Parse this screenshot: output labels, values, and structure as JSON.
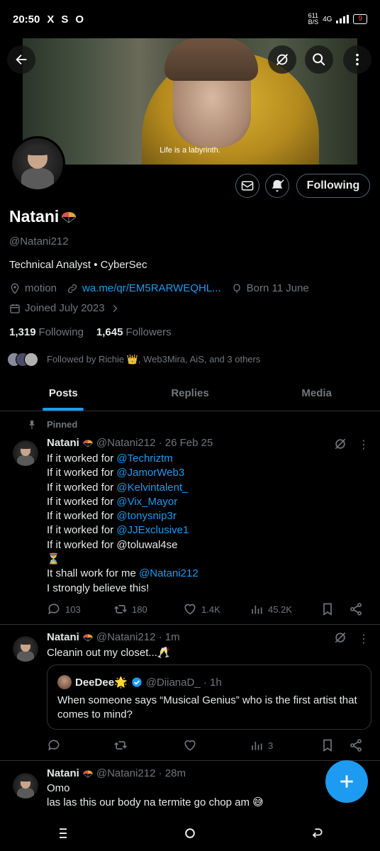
{
  "status_bar": {
    "time": "20:50",
    "left_icons": [
      "X",
      "S",
      "O"
    ],
    "net_speed": "611\nB/S",
    "network": "4G",
    "battery": "9"
  },
  "header": {
    "banner_caption": "Life is a labyrinth."
  },
  "profile": {
    "name": "Natani",
    "handle": "@Natani212",
    "bio": "Technical Analyst • CyberSec",
    "location": "motion",
    "link": "wa.me/qr/EM5RARWEQHL...",
    "birthday": "Born 11 June",
    "joined": "Joined July 2023",
    "following_count": "1,319",
    "following_label": "Following",
    "followers_count": "1,645",
    "followers_label": "Followers",
    "followed_by": "Followed by Richie 👑, Web3Mira, AiS, and 3 others",
    "following_button": "Following"
  },
  "tabs": [
    {
      "label": "Posts",
      "active": true
    },
    {
      "label": "Replies",
      "active": false
    },
    {
      "label": "Media",
      "active": false
    }
  ],
  "tweets": [
    {
      "pinned_label": "Pinned",
      "name": "Natani",
      "handle_time": "@Natani212 · 26 Feb 25",
      "lines": [
        {
          "text": "If it worked for ",
          "mention": "@Techriztm"
        },
        {
          "text": "If it worked for ",
          "mention": "@JamorWeb3"
        },
        {
          "text": "If it  worked for ",
          "mention": "@Kelvintalent_"
        },
        {
          "text": "If it  worked for ",
          "mention": "@Vix_Mayor"
        },
        {
          "text": "If it  worked for ",
          "mention": "@tonysnip3r"
        },
        {
          "text": "If it  worked for ",
          "mention": "@JJExclusive1"
        },
        {
          "text": "If it  worked for @toluwal4se",
          "mention": ""
        },
        {
          "text": "⏳",
          "mention": ""
        },
        {
          "text": "It shall work for me ",
          "mention": "@Natani212"
        },
        {
          "text": "I strongly believe this!",
          "mention": ""
        }
      ],
      "replies": "103",
      "retweets": "180",
      "likes": "1.4K",
      "views": "45.2K"
    },
    {
      "name": "Natani",
      "handle_time": "@Natani212 · 1m",
      "text": "Cleanin out my closet...🥂",
      "quote": {
        "name": "DeeDee🌟",
        "handle_time": "@DiianaD_ · 1h",
        "text": "When someone says “Musical Genius” who is the first artist that comes to mind?"
      },
      "views": "3"
    },
    {
      "name": "Natani",
      "handle_time": "@Natani212 · 28m",
      "line1": "Omo",
      "line2": "las las this our body na termite go chop am 😅"
    }
  ],
  "colors": {
    "accent": "#1d9bf0",
    "muted": "#71767b",
    "border": "#2f3336"
  }
}
